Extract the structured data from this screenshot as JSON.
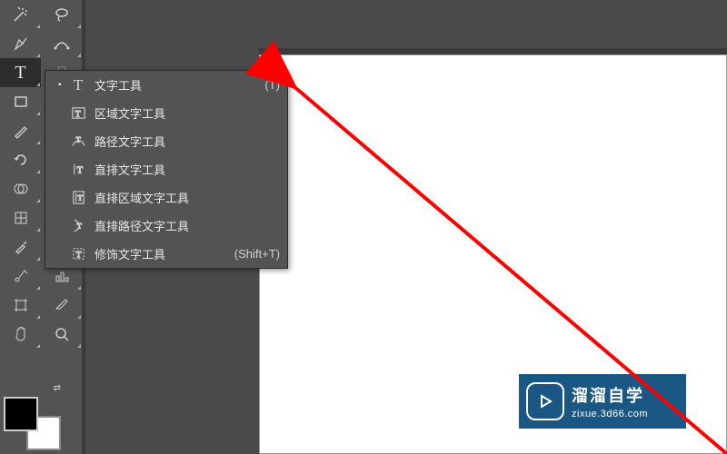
{
  "tools": {
    "row1": [
      "star",
      "lasso"
    ],
    "row2": [
      "pen",
      "segment"
    ],
    "row3": [
      "type",
      "dot"
    ],
    "row4": [
      "rect",
      "line"
    ],
    "row5": [
      "brush",
      "eraser"
    ],
    "row6": [
      "rotate",
      "scale"
    ],
    "row7": [
      "shape",
      "perspective"
    ],
    "row8": [
      "mesh",
      "gradient"
    ],
    "row9": [
      "dropper",
      "swatch"
    ],
    "row10": [
      "symbol",
      "graph"
    ],
    "row11": [
      "crop",
      "slice"
    ],
    "row12": [
      "hand",
      "zoom"
    ]
  },
  "flyout": {
    "items": [
      {
        "selected": true,
        "icon": "T",
        "label": "文字工具",
        "shortcut": "(T)"
      },
      {
        "selected": false,
        "icon": "aT",
        "label": "区域文字工具",
        "shortcut": ""
      },
      {
        "selected": false,
        "icon": "pT",
        "label": "路径文字工具",
        "shortcut": ""
      },
      {
        "selected": false,
        "icon": "vT",
        "label": "直排文字工具",
        "shortcut": ""
      },
      {
        "selected": false,
        "icon": "vaT",
        "label": "直排区域文字工具",
        "shortcut": ""
      },
      {
        "selected": false,
        "icon": "vpT",
        "label": "直排路径文字工具",
        "shortcut": ""
      },
      {
        "selected": false,
        "icon": "tT",
        "label": "修饰文字工具",
        "shortcut": "(Shift+T)"
      }
    ]
  },
  "watermark": {
    "title": "溜溜自学",
    "url": "zixue.3d66.com"
  }
}
